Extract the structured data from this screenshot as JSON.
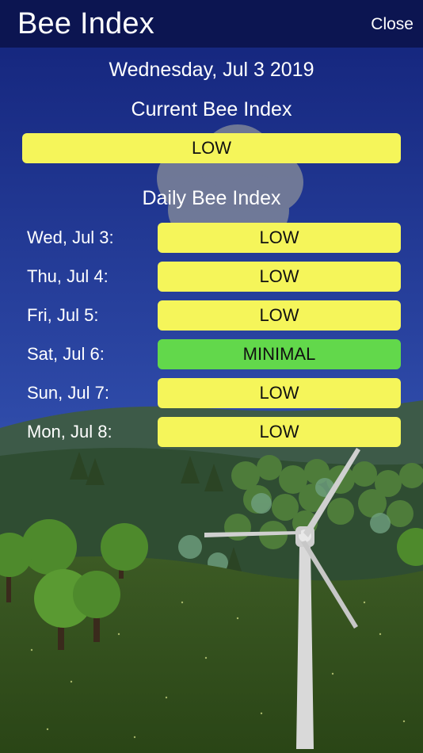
{
  "header": {
    "title": "Bee Index",
    "close_label": "Close"
  },
  "date": "Wednesday, Jul 3 2019",
  "current": {
    "title": "Current Bee Index",
    "level": "LOW"
  },
  "daily": {
    "title": "Daily Bee Index",
    "days": [
      {
        "label": "Wed, Jul 3:",
        "level": "LOW"
      },
      {
        "label": "Thu, Jul 4:",
        "level": "LOW"
      },
      {
        "label": "Fri, Jul 5:",
        "level": "LOW"
      },
      {
        "label": "Sat, Jul 6:",
        "level": "MINIMAL"
      },
      {
        "label": "Sun, Jul 7:",
        "level": "LOW"
      },
      {
        "label": "Mon, Jul 8:",
        "level": "LOW"
      }
    ]
  },
  "colors": {
    "low": "#f5f55a",
    "minimal": "#62d84b",
    "topbar": "#0c1551"
  }
}
